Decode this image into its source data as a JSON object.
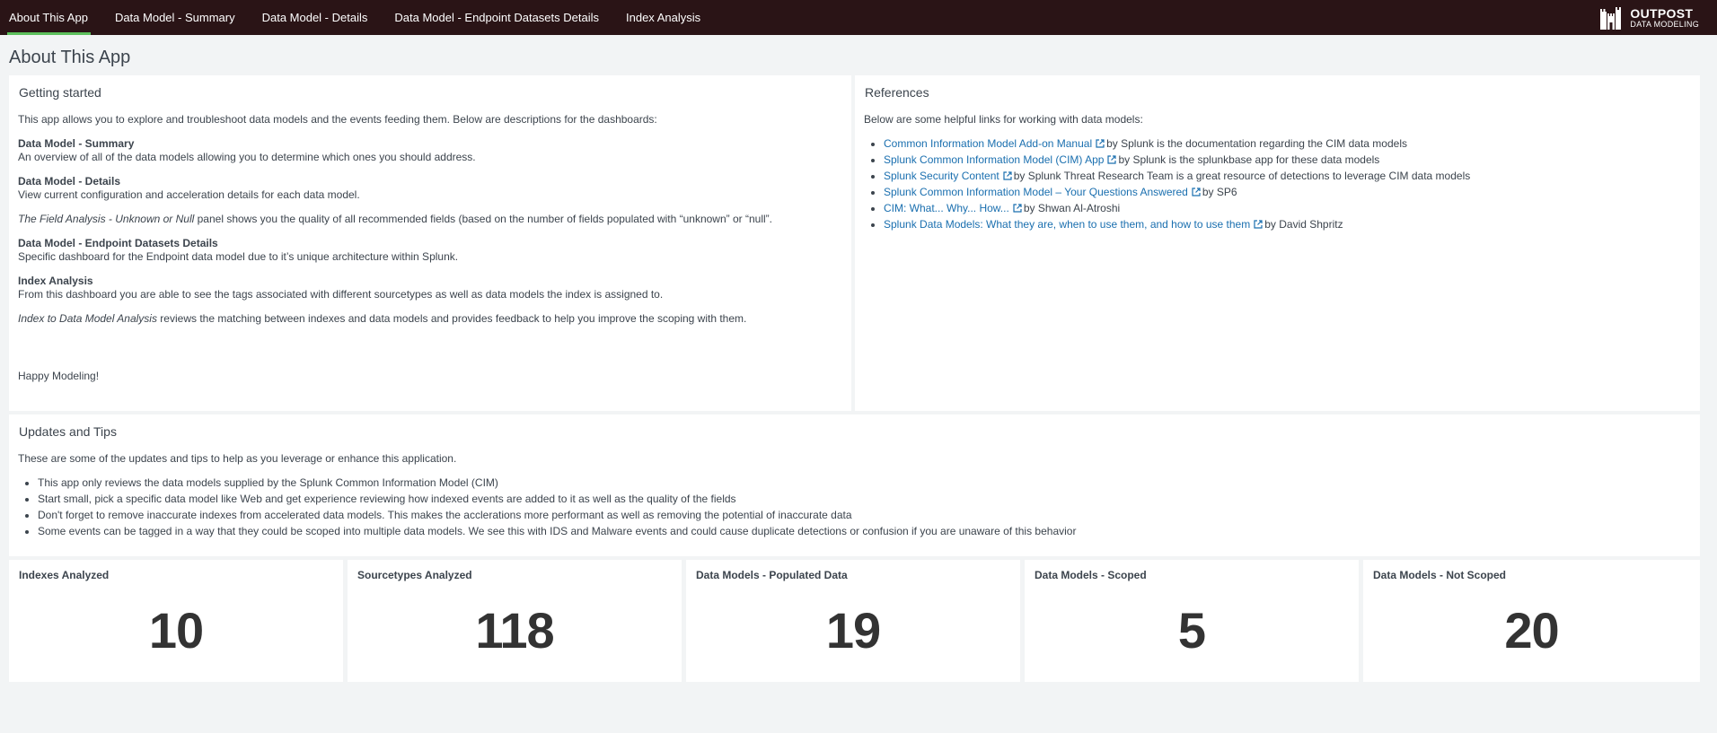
{
  "nav": {
    "items": [
      {
        "label": "About This App",
        "active": true
      },
      {
        "label": "Data Model - Summary"
      },
      {
        "label": "Data Model - Details"
      },
      {
        "label": "Data Model - Endpoint Datasets Details"
      },
      {
        "label": "Index Analysis"
      }
    ],
    "brand_line1": "OUTPOST",
    "brand_line2": "DATA MODELING"
  },
  "page_title": "About This App",
  "getting_started": {
    "title": "Getting started",
    "intro": "This app allows you to explore and troubleshoot data models and the events feeding them. Below are descriptions for the dashboards:",
    "summary_heading": "Data Model - Summary",
    "summary_text": "An overview of all of the data models allowing you to determine which ones you should address.",
    "details_heading": "Data Model - Details",
    "details_text": "View current configuration and acceleration details for each data model.",
    "field_analysis_em": "The Field Analysis - Unknown or Null",
    "field_analysis_text": " panel shows you the quality of all recommended fields (based on the number of fields populated with “unknown” or “null”.",
    "endpoint_heading": "Data Model - Endpoint Datasets Details",
    "endpoint_text": "Specific dashboard for the Endpoint data model due to it’s unique architecture within Splunk.",
    "index_heading": "Index Analysis",
    "index_text": "From this dashboard you are able to see the tags associated with different sourcetypes as well as data models the index is assigned to.",
    "index_dm_em": "Index to Data Model Analysis",
    "index_dm_text": " reviews the matching between indexes and data models and provides feedback to help you improve the scoping with them.",
    "closing": "Happy Modeling!"
  },
  "references": {
    "title": "References",
    "intro": "Below are some helpful links for working with data models:",
    "links": [
      {
        "text": "Common Information Model Add-on Manual",
        "suffix": "by Splunk is the documentation regarding the CIM data models"
      },
      {
        "text": "Splunk Common Information Model (CIM) App",
        "suffix": "by Splunk is the splunkbase app for these data models"
      },
      {
        "text": "Splunk Security Content",
        "suffix": "by Splunk Threat Research Team is a great resource of detections to leverage CIM data models"
      },
      {
        "text": "Splunk Common Information Model – Your Questions Answered",
        "suffix": "by SP6"
      },
      {
        "text": "CIM: What... Why... How...",
        "suffix": "by Shwan Al-Atroshi"
      },
      {
        "text": "Splunk Data Models: What they are, when to use them, and how to use them",
        "suffix": "by David Shpritz"
      }
    ]
  },
  "updates": {
    "title": "Updates and Tips",
    "intro": "These are some of the updates and tips to help as you leverage or enhance this application.",
    "tips": [
      "This app only reviews the data models supplied by the Splunk Common Information Model (CIM)",
      "Start small, pick a specific data model like Web and get experience reviewing how indexed events are added to it as well as the quality of the fields",
      "Don't forget to remove inaccurate indexes from accelerated data models. This makes the acclerations more performant as well as removing the potential of inaccurate data",
      "Some events can be tagged in a way that they could be scoped into multiple data models. We see this with IDS and Malware events and could cause duplicate detections or confusion if you are unaware of this behavior"
    ]
  },
  "stats": [
    {
      "title": "Indexes Analyzed",
      "value": "10"
    },
    {
      "title": "Sourcetypes Analyzed",
      "value": "118"
    },
    {
      "title": "Data Models - Populated Data",
      "value": "19"
    },
    {
      "title": "Data Models - Scoped",
      "value": "5"
    },
    {
      "title": "Data Models - Not Scoped",
      "value": "20"
    }
  ],
  "colors": {
    "topbar": "#2a1416",
    "active_underline": "#5cc05c",
    "link": "#1a6faf",
    "background": "#f2f4f5"
  }
}
